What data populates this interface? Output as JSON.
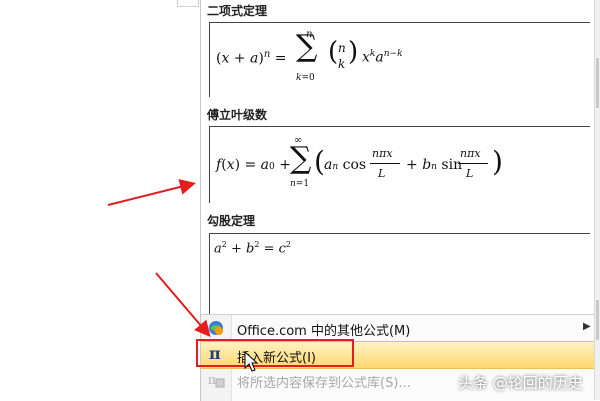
{
  "gallery": {
    "sections": [
      {
        "title": "二项式定理"
      },
      {
        "title": "傅立叶级数"
      },
      {
        "title": "勾股定理"
      }
    ]
  },
  "menu": {
    "items": [
      {
        "label": "Office.com 中的其他公式(M)",
        "has_submenu": true,
        "icon": "office-globe-icon"
      },
      {
        "label": "插入新公式(I)",
        "highlighted": true,
        "icon": "pi-icon"
      },
      {
        "label": "将所选内容保存到公式库(S)...",
        "disabled": true,
        "icon": "save-equation-icon"
      }
    ]
  },
  "watermark": "头条 @轮回的历史",
  "colors": {
    "highlight": "#ffd970",
    "annotation_red": "#e31c1c"
  }
}
